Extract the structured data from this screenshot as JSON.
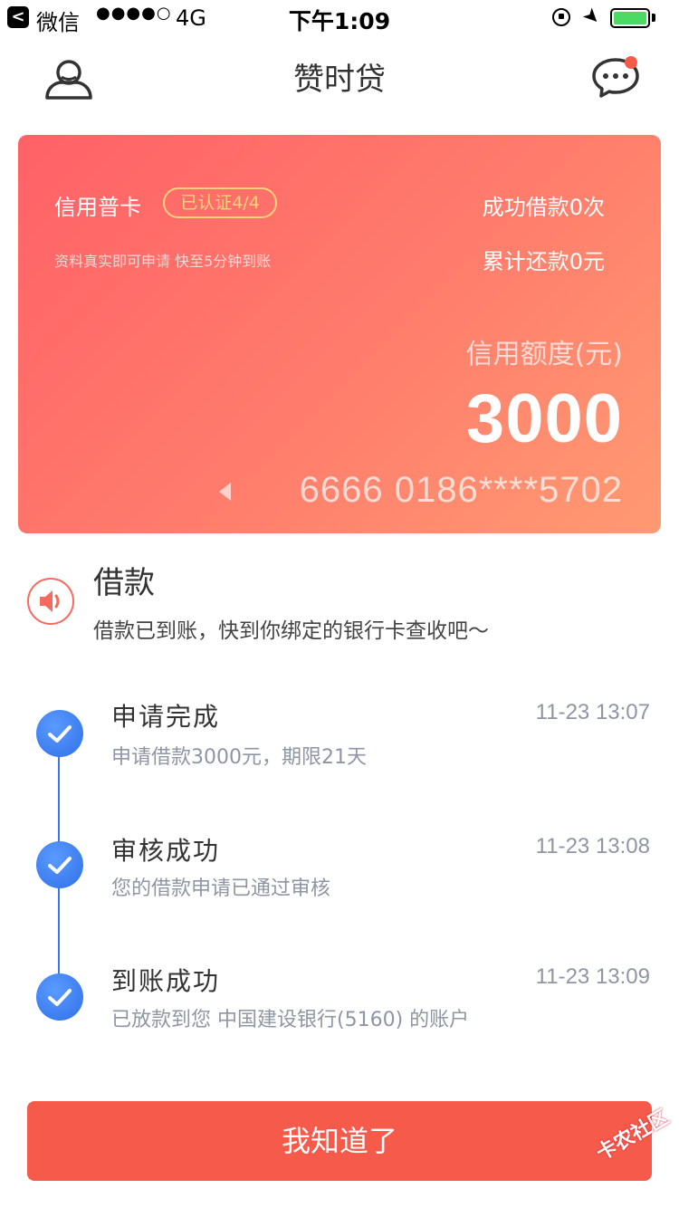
{
  "status_bar": {
    "back_glyph": "<",
    "app": "微信",
    "signal": "●●●●○",
    "network": "4G",
    "time": "下午1:09",
    "location_glyph": "➤",
    "battery_color": "#4cd964"
  },
  "nav": {
    "title": "赞时贷",
    "left_icon": "user-icon",
    "right_icon": "message-icon",
    "badge_color": "#f35b4a"
  },
  "card": {
    "type": "信用普卡",
    "badge": "已认证4/4",
    "subtitle": "资料真实即可申请 快至5分钟到账",
    "loans": "成功借款0次",
    "repayment": "累计还款0元",
    "limit_label": "信用额度(元)",
    "amount": "3000",
    "card_number": "6666 0186****5702",
    "gradient_start": "#ff6167",
    "gradient_end": "#ff9a72"
  },
  "notice": {
    "icon": "speaker-icon",
    "title": "借款",
    "description": "借款已到账，快到你绑定的银行卡查收吧～"
  },
  "timeline": [
    {
      "title": "申请完成",
      "time": "11-23 13:07",
      "description": "申请借款3000元，期限21天"
    },
    {
      "title": "审核成功",
      "time": "11-23 13:08",
      "description": "您的借款申请已通过审核"
    },
    {
      "title": "到账成功",
      "time": "11-23 13:09",
      "description": "已放款到您 中国建设银行(5160) 的账户"
    }
  ],
  "accent_color": "#3b77e8",
  "button": {
    "label": "我知道了",
    "color": "#f65a4a"
  },
  "watermark": "卡农社区"
}
